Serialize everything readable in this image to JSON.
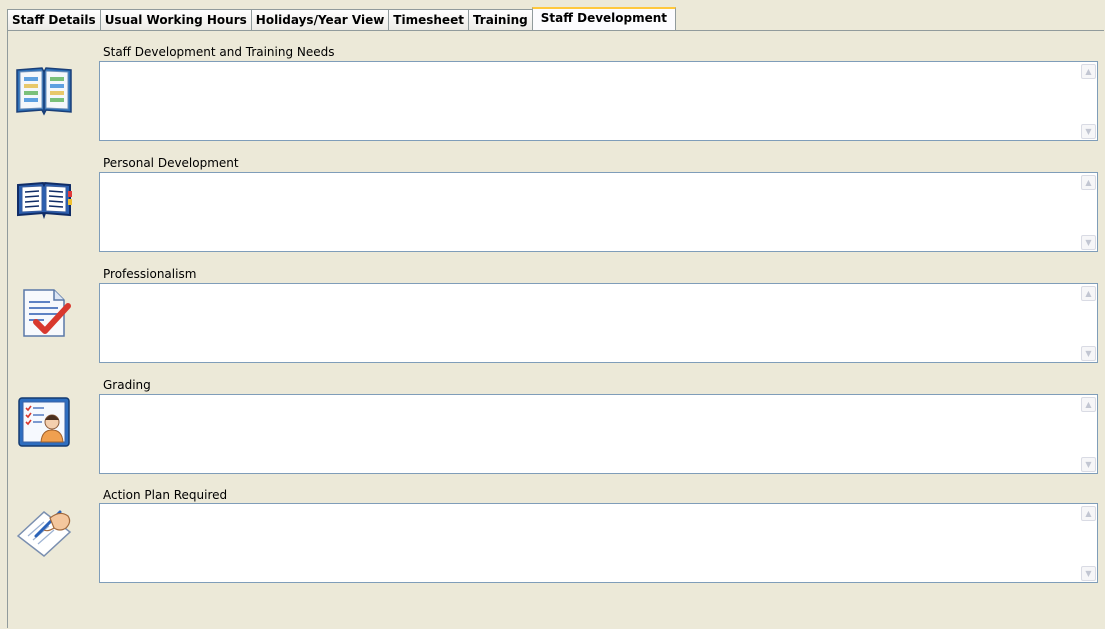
{
  "tabs": [
    {
      "label": "Staff Details",
      "active": false
    },
    {
      "label": "Usual Working Hours",
      "active": false
    },
    {
      "label": "Holidays/Year View",
      "active": false
    },
    {
      "label": "Timesheet",
      "active": false
    },
    {
      "label": "Training",
      "active": false
    },
    {
      "label": "Staff Development",
      "active": true
    }
  ],
  "sections": [
    {
      "label": "Staff Development and Training Needs",
      "value": "",
      "icon": "open-book-icon"
    },
    {
      "label": "Personal Development",
      "value": "",
      "icon": "book-icon"
    },
    {
      "label": "Professionalism",
      "value": "",
      "icon": "document-check-icon"
    },
    {
      "label": "Grading",
      "value": "",
      "icon": "checklist-person-icon"
    },
    {
      "label": "Action Plan Required",
      "value": "",
      "icon": "hand-writing-icon"
    }
  ],
  "scroll": {
    "up_glyph": "▲",
    "down_glyph": "▼"
  },
  "colors": {
    "window_bg": "#ECE9D8",
    "active_tab_accent": "#FFC83C",
    "field_border": "#7F9DB9"
  }
}
